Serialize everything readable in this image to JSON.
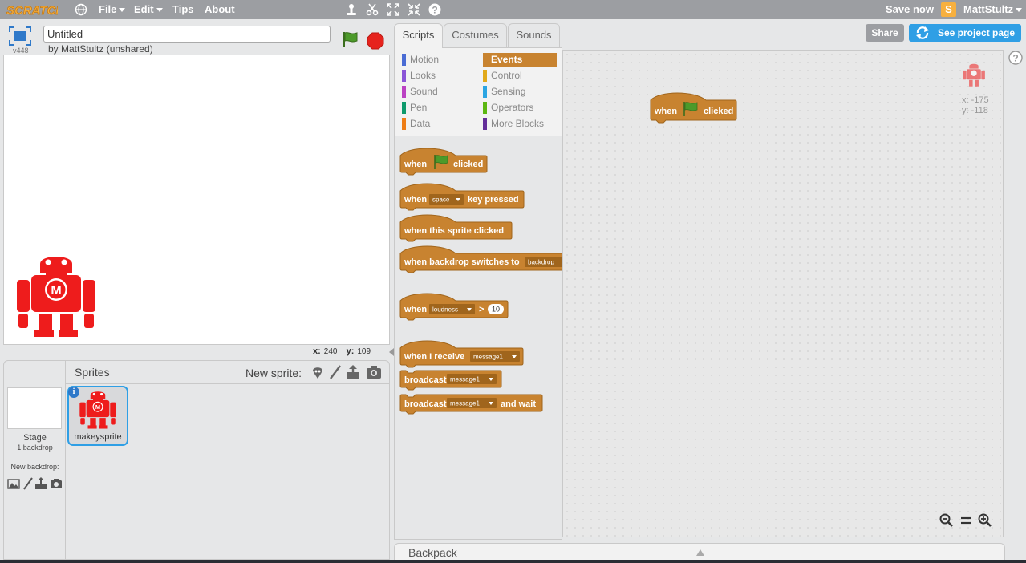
{
  "menubar": {
    "logo_text": "SCRATCH",
    "file": "File",
    "edit": "Edit",
    "tips": "Tips",
    "about": "About",
    "save_now": "Save now",
    "user_badge": "S",
    "username": "MattStultz",
    "icons": [
      "globe-icon",
      "duplicate-icon",
      "cut-icon",
      "grow-icon",
      "shrink-icon",
      "help-icon"
    ]
  },
  "stage": {
    "version": "v448",
    "title_value": "Untitled",
    "byline": "by MattStultz (unshared)",
    "mouse_x_label": "x:",
    "mouse_x": "240",
    "mouse_y_label": "y:",
    "mouse_y": "109",
    "sprite_letter": "M"
  },
  "sprites_pane": {
    "title": "Sprites",
    "new_sprite_label": "New sprite:",
    "stage_label": "Stage",
    "backdrop_count": "1 backdrop",
    "new_backdrop_label": "New backdrop:",
    "selected_sprite": "makeysprite",
    "info_glyph": "i",
    "sprite_letter": "M"
  },
  "tabs": [
    "Scripts",
    "Costumes",
    "Sounds"
  ],
  "active_tab": "Scripts",
  "categories": {
    "left": [
      {
        "label": "Motion",
        "color": "#4a6cd4"
      },
      {
        "label": "Looks",
        "color": "#8a55d7"
      },
      {
        "label": "Sound",
        "color": "#bb42c3"
      },
      {
        "label": "Pen",
        "color": "#0e9a6c"
      },
      {
        "label": "Data",
        "color": "#ee7d16"
      }
    ],
    "right": [
      {
        "label": "Events",
        "color": "#c88330"
      },
      {
        "label": "Control",
        "color": "#e1a91a"
      },
      {
        "label": "Sensing",
        "color": "#2ca5e2"
      },
      {
        "label": "Operators",
        "color": "#5cb712"
      },
      {
        "label": "More Blocks",
        "color": "#632d99"
      }
    ],
    "selected": "Events"
  },
  "blocks": {
    "when": "when",
    "clicked": "clicked",
    "key_pressed": "key pressed",
    "space": "space",
    "when_this_sprite_clicked": "when this sprite clicked",
    "when_backdrop_switches_to": "when backdrop switches to",
    "backdrop": "backdrop",
    "loudness": "loudness",
    "gt": ">",
    "loudness_value": "10",
    "when_i_receive": "when I receive",
    "message1": "message1",
    "broadcast": "broadcast",
    "and_wait": "and wait",
    "events_color": "#c88330",
    "dark_color": "#a0651c"
  },
  "scripts_area": {
    "sprite_x": "x: -175",
    "sprite_y": "y: -118",
    "script_hat_when": "when",
    "script_hat_clicked": "clicked"
  },
  "header_buttons": {
    "share": "Share",
    "see_project_page": "See project page"
  },
  "backpack": {
    "label": "Backpack"
  }
}
